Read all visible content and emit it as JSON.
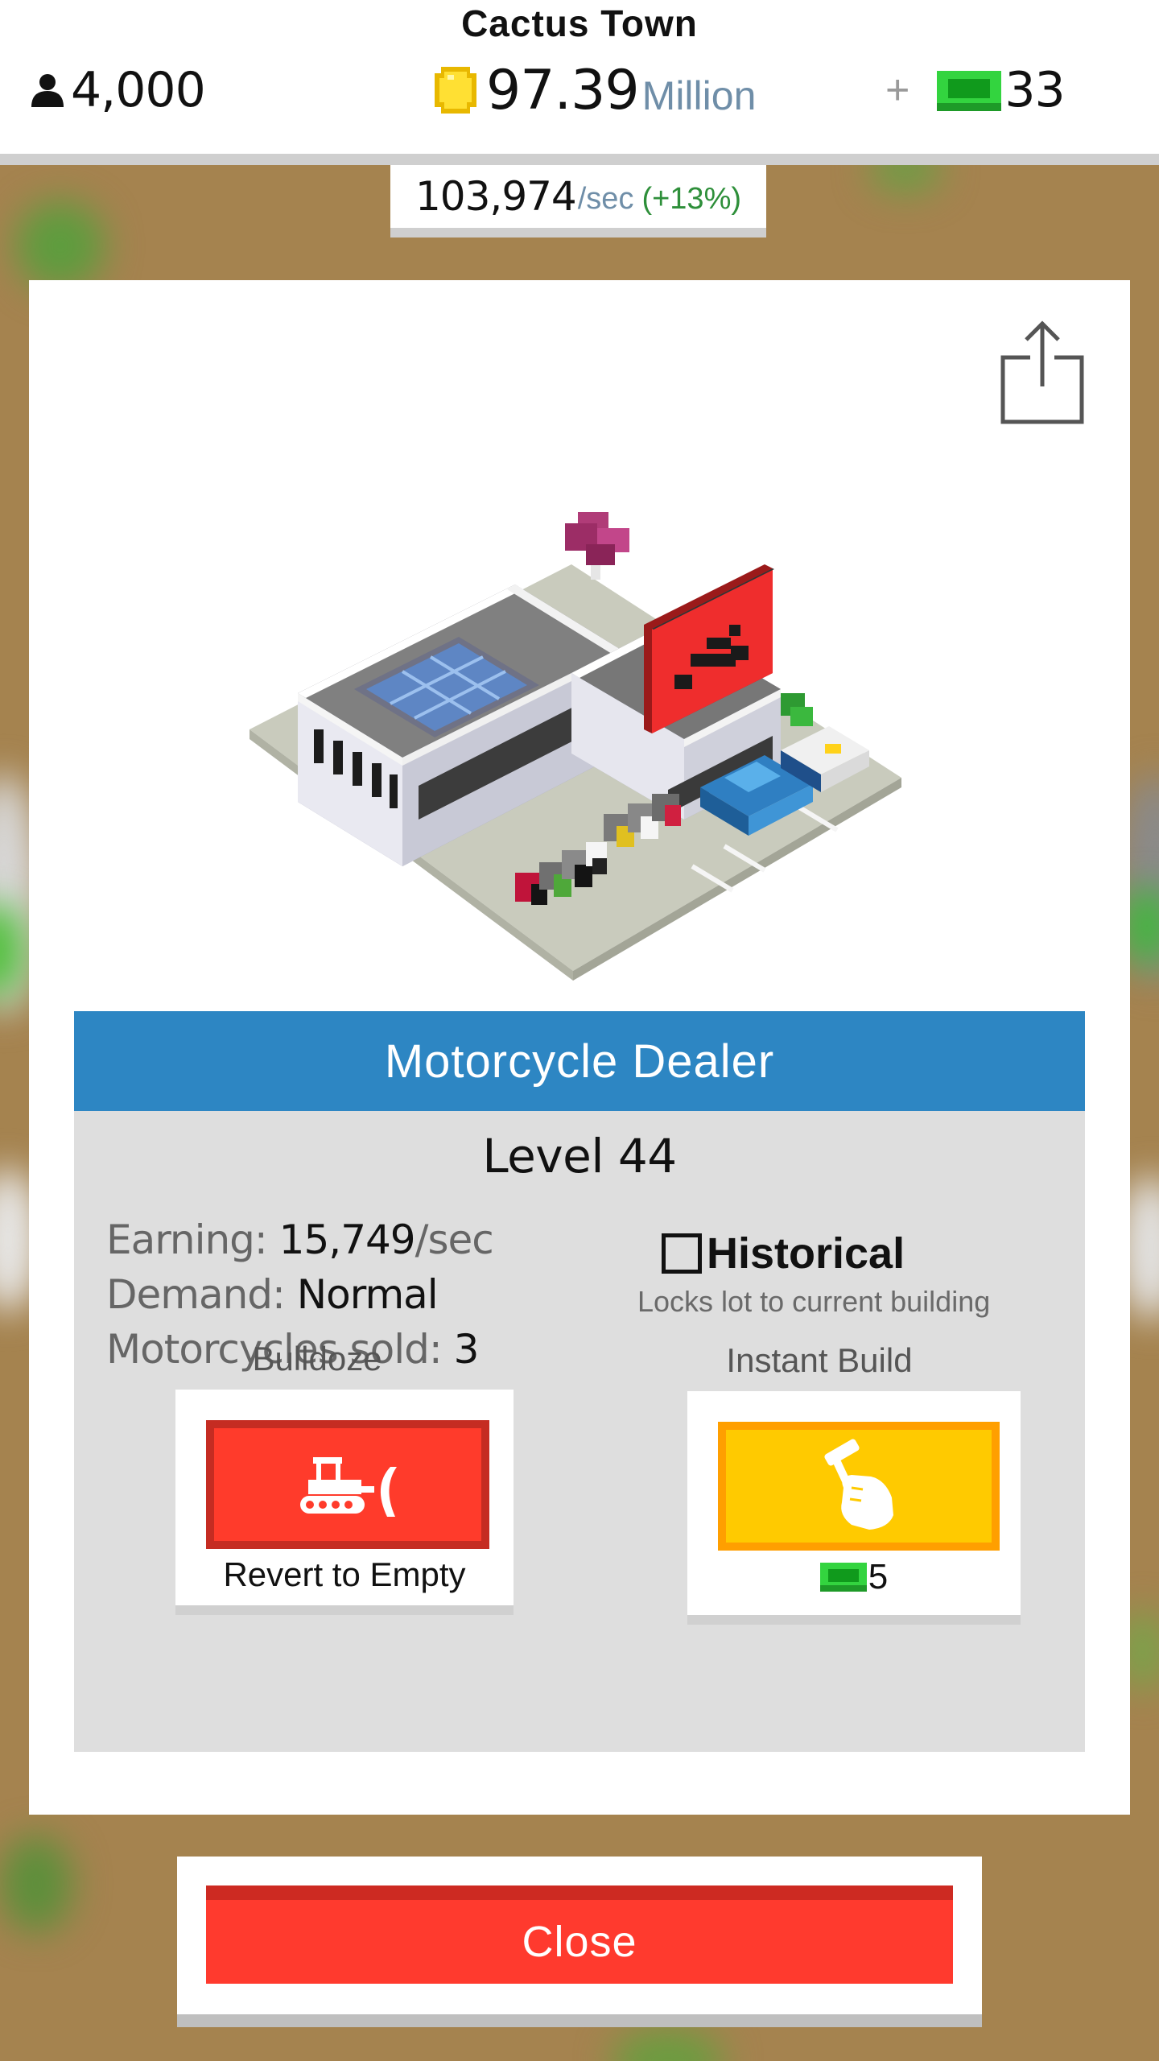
{
  "header": {
    "town_name": "Cactus Town",
    "population": "4,000",
    "money_value": "97.39",
    "money_unit": "Million",
    "plus_label": "+",
    "bucks": "33",
    "rate_value": "103,974",
    "rate_unit": "/sec",
    "rate_bonus": "(+13%)"
  },
  "building": {
    "name": "Motorcycle Dealer",
    "level": "Level 44",
    "stats": [
      {
        "label": "Earning: ",
        "value": "15,749",
        "unit": "/sec"
      },
      {
        "label": "Demand: ",
        "value": "Normal",
        "unit": ""
      },
      {
        "label": "Motorcycles sold: ",
        "value": "3",
        "unit": ""
      }
    ],
    "historical_label": "Historical",
    "historical_checked": false,
    "historical_sub": "Locks lot to current building"
  },
  "actions": {
    "bulldoze_label": "Bulldoze",
    "bulldoze_caption": "Revert to Empty",
    "instant_label": "Instant Build",
    "instant_cost": "5"
  },
  "close_label": "Close",
  "colors": {
    "title_bar": "#2d86c3",
    "bulldoze": "#ff3b2b",
    "instant": "#ffca00",
    "close": "#ff3a2e",
    "bux_green": "#1fbf2f"
  },
  "icons": {
    "population": "person-icon",
    "money": "coin-icon",
    "bucks": "bux-bill-icon",
    "share": "share-icon",
    "bulldoze": "bulldozer-icon",
    "instant": "hammer-hand-icon"
  }
}
